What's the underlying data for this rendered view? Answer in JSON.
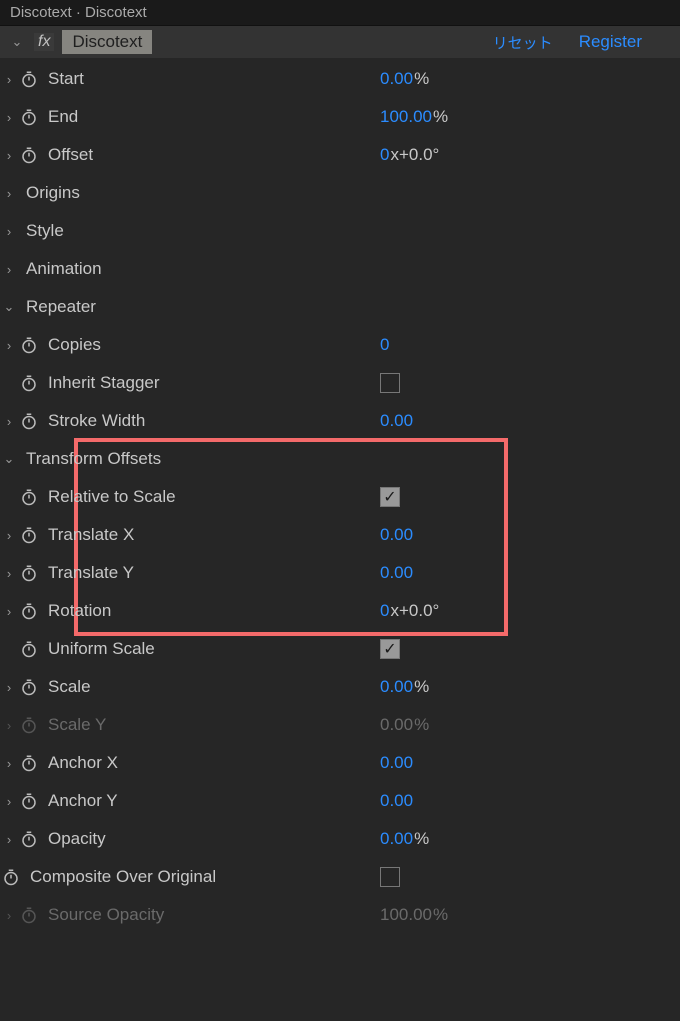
{
  "titlebar": "Discotext · Discotext",
  "fx": {
    "label": "fx",
    "name": "Discotext",
    "reset": "リセット",
    "register": "Register"
  },
  "props": {
    "start": {
      "label": "Start",
      "value": "0.00",
      "unit": "%"
    },
    "end": {
      "label": "End",
      "value": "100.00",
      "unit": "%"
    },
    "offset": {
      "label": "Offset",
      "value": "0",
      "angle": "x+0.0°"
    },
    "origins": {
      "label": "Origins"
    },
    "style": {
      "label": "Style"
    },
    "animation": {
      "label": "Animation"
    },
    "repeater": {
      "label": "Repeater",
      "copies": {
        "label": "Copies",
        "value": "0"
      },
      "inherit_stagger": {
        "label": "Inherit Stagger"
      },
      "stroke_width": {
        "label": "Stroke Width",
        "value": "0.00"
      },
      "transform_offsets": {
        "label": "Transform Offsets",
        "relative_to_scale": {
          "label": "Relative to Scale"
        },
        "translate_x": {
          "label": "Translate X",
          "value": "0.00"
        },
        "translate_y": {
          "label": "Translate Y",
          "value": "0.00"
        },
        "rotation": {
          "label": "Rotation",
          "value": "0",
          "angle": "x+0.0°"
        },
        "uniform_scale": {
          "label": "Uniform Scale"
        },
        "scale": {
          "label": "Scale",
          "value": "0.00",
          "unit": "%"
        },
        "scale_y": {
          "label": "Scale Y",
          "value": "0.00",
          "unit": "%"
        },
        "anchor_x": {
          "label": "Anchor X",
          "value": "0.00"
        },
        "anchor_y": {
          "label": "Anchor Y",
          "value": "0.00"
        },
        "opacity": {
          "label": "Opacity",
          "value": "0.00",
          "unit": "%"
        }
      },
      "composite_over_original": {
        "label": "Composite Over Original"
      }
    },
    "source_opacity": {
      "label": "Source Opacity",
      "value": "100.00",
      "unit": "%"
    }
  }
}
